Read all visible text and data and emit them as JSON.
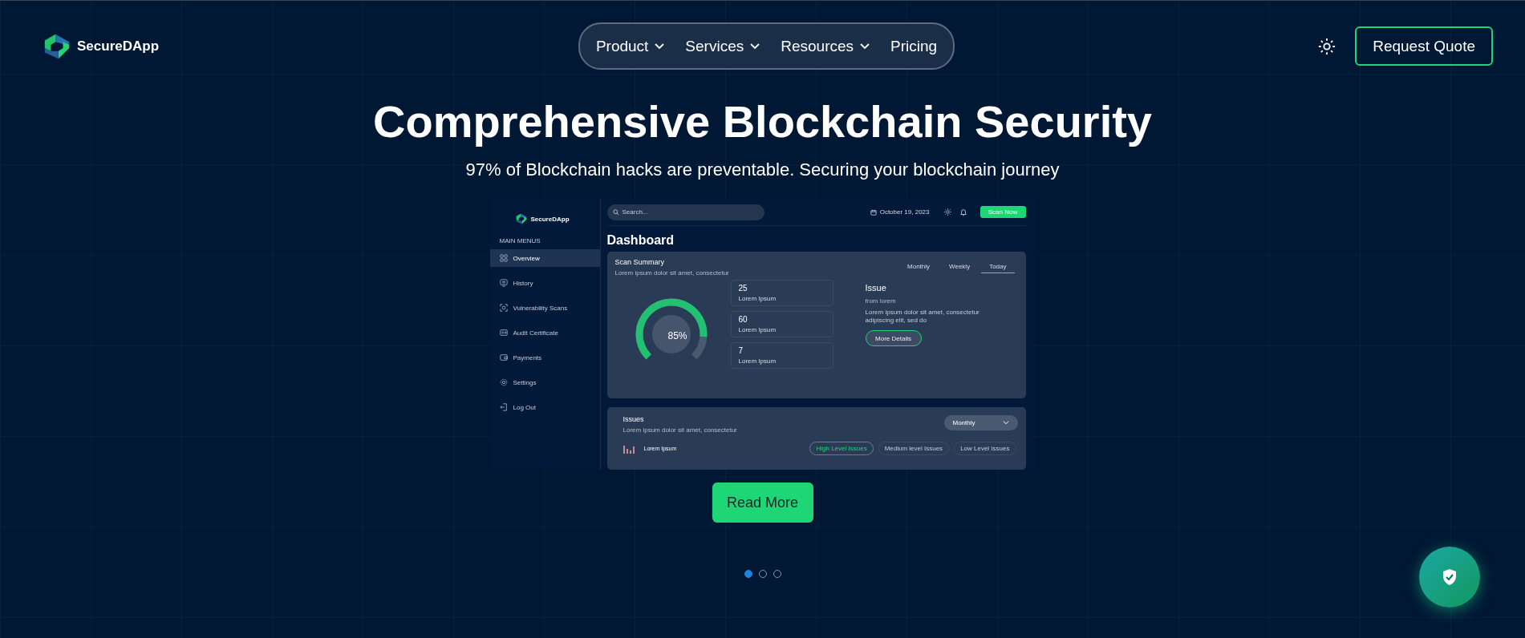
{
  "header": {
    "brand": "SecureDApp",
    "nav": [
      {
        "label": "Product",
        "dropdown": true
      },
      {
        "label": "Services",
        "dropdown": true
      },
      {
        "label": "Resources",
        "dropdown": true
      },
      {
        "label": "Pricing",
        "dropdown": false
      }
    ],
    "cta": "Request Quote"
  },
  "hero": {
    "title": "Comprehensive Blockchain Security",
    "subtitle": "97% of Blockchain hacks are preventable. Securing your blockchain journey"
  },
  "dashboard": {
    "brand": "SecureDApp",
    "search": {
      "placeholder": "Search..."
    },
    "date": "October 19, 2023",
    "scan_button": "Scan Now",
    "menu_heading": "MAIN MENUS",
    "menu": [
      {
        "label": "Overview",
        "selected": true
      },
      {
        "label": "History",
        "selected": false
      },
      {
        "label": "Vulnerability Scans",
        "selected": false
      },
      {
        "label": "Audit Certificate",
        "selected": false
      },
      {
        "label": "Payments",
        "selected": false
      },
      {
        "label": "Settings",
        "selected": false
      },
      {
        "label": "Log Out",
        "selected": false
      }
    ],
    "title": "Dashboard",
    "summary": {
      "title": "Scan Summary",
      "subtitle": "Lorem ipsum dolor sit amet, consectetur",
      "tabs": [
        {
          "label": "Monthly",
          "selected": false
        },
        {
          "label": "Weekly",
          "selected": false
        },
        {
          "label": "Today",
          "selected": true
        }
      ],
      "gauge": {
        "reading": "85%"
      },
      "stats": [
        {
          "value": "25",
          "label": "Lorem Ipsum"
        },
        {
          "value": "60",
          "label": "Lorem Ipsum"
        },
        {
          "value": "7",
          "label": "Lorem Ipsum"
        }
      ],
      "issue": {
        "title": "Issue",
        "from": "from lorem",
        "text": "Lorem ipsum dolor sit amet, consectetur adipiscing elit, sed do",
        "button": "More Details"
      }
    },
    "issues": {
      "title": "Issues",
      "subtitle": "Lorem ipsum dolor sit amet, consectetur",
      "period": "Monthly",
      "row_label": "Lorem Ipsum",
      "filters": [
        {
          "label": "High Level Issues",
          "selected": true
        },
        {
          "label": "Medium level Issues",
          "selected": false
        },
        {
          "label": "Low Level Issues",
          "selected": false
        }
      ]
    }
  },
  "read_more": "Read More",
  "carousel": [
    {
      "selected": true
    },
    {
      "selected": false
    },
    {
      "selected": false
    }
  ]
}
